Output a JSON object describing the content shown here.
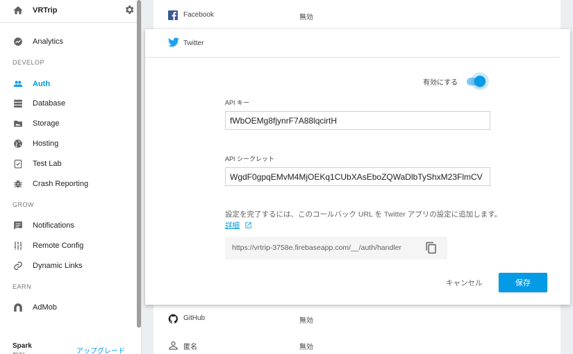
{
  "sidebar": {
    "project_name": "VRTrip",
    "items": [
      {
        "label": "Analytics",
        "icon": "analytics-icon"
      },
      {
        "label": "Auth",
        "icon": "auth-icon",
        "active": true
      },
      {
        "label": "Database",
        "icon": "database-icon"
      },
      {
        "label": "Storage",
        "icon": "storage-icon"
      },
      {
        "label": "Hosting",
        "icon": "hosting-icon"
      },
      {
        "label": "Test Lab",
        "icon": "testlab-icon"
      },
      {
        "label": "Crash Reporting",
        "icon": "crash-icon"
      },
      {
        "label": "Notifications",
        "icon": "notifications-icon"
      },
      {
        "label": "Remote Config",
        "icon": "remote-config-icon"
      },
      {
        "label": "Dynamic Links",
        "icon": "link-icon"
      },
      {
        "label": "AdMob",
        "icon": "admob-icon"
      }
    ],
    "sections": {
      "develop": "DEVELOP",
      "grow": "GROW",
      "earn": "EARN"
    },
    "plan_name": "Spark",
    "plan_sub": "無料",
    "upgrade_label": "アップグレード"
  },
  "providers": {
    "facebook": {
      "name": "Facebook",
      "status": "無効"
    },
    "github": {
      "name": "GitHub",
      "status": "無効"
    },
    "anonymous": {
      "name": "匿名",
      "status": "無効"
    }
  },
  "dialog": {
    "provider_name": "Twitter",
    "enable_label": "有効にする",
    "enabled": true,
    "api_key_label": "API キー",
    "api_key_value": "fWbOEMg8fjynrF7A88lqcirtH",
    "api_secret_label": "API シークレット",
    "api_secret_value": "WgdF0gpqEMvM4MjOEKq1CUbXAsEboZQWaDlbTyShxM23FlmCV",
    "help_text": "設定を完了するには、このコールバック URL を Twitter アプリの設定に追加します。",
    "help_link": "詳細",
    "callback_url": "https://vrtrip-3758e.firebaseapp.com/__/auth/handler",
    "cancel_label": "キャンセル",
    "save_label": "保存"
  },
  "colors": {
    "accent": "#039be5",
    "twitter": "#1da1f2",
    "facebook": "#3b5998"
  }
}
